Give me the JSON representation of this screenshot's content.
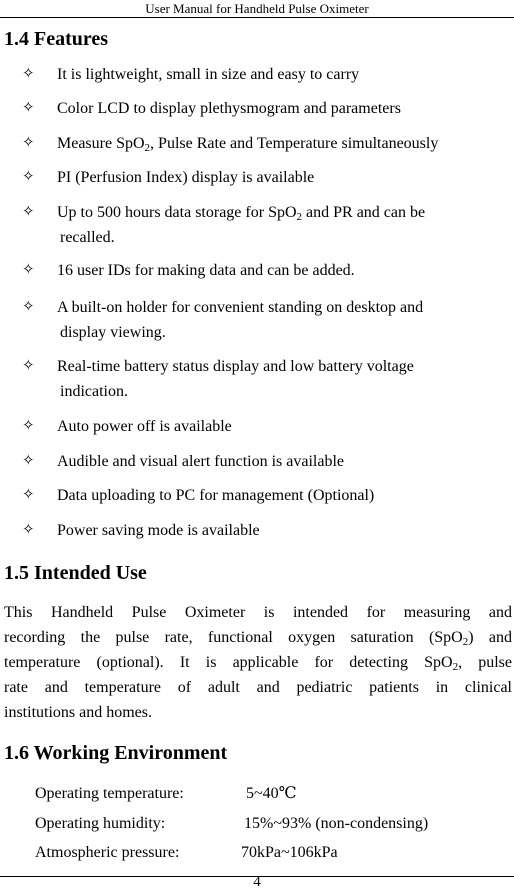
{
  "header": {
    "title": "User Manual for Handheld Pulse Oximeter"
  },
  "sections": {
    "features": {
      "heading": "1.4 Features",
      "bullet_icon": "four-pointed-star-outline-icon",
      "bullet_glyph": "✧",
      "items": [
        {
          "text": "It is lightweight, small in size and easy to carry"
        },
        {
          "text": "Color LCD to display plethysmogram and parameters"
        },
        {
          "pre": "Measure SpO",
          "sub": "2",
          "post": ", Pulse Rate and Temperature simultaneously"
        },
        {
          "text": "PI (Perfusion Index) display is available"
        },
        {
          "pre": "Up to 500 hours data storage for SpO",
          "sub": "2",
          "post": " and PR and can be",
          "cont": "recalled."
        },
        {
          "text": "16 user IDs for making data and can be added."
        },
        {
          "text": "A built-on holder for convenient standing on desktop and",
          "cont": "display viewing."
        },
        {
          "text": "Real-time battery status display and low battery voltage",
          "cont": "indication."
        },
        {
          "text": "Auto power off is available"
        },
        {
          "text": "Audible and visual alert function is available"
        },
        {
          "text": "Data uploading to PC for management (Optional)"
        },
        {
          "text": "Power saving mode is available"
        }
      ]
    },
    "intended_use": {
      "heading": "1.5 Intended Use",
      "line1": "This Handheld Pulse Oximeter is intended for measuring and",
      "line2_pre": "recording the pulse rate, functional oxygen saturation (SpO",
      "line2_sub": "2",
      "line2_post": ") and",
      "line3_pre": "temperature (optional). It is applicable for detecting SpO",
      "line3_sub": "2",
      "line3_post": ", pulse",
      "line4": "rate and temperature of adult and pediatric patients in clinical",
      "line5": "institutions and homes."
    },
    "working_environment": {
      "heading": "1.6 Working Environment",
      "rows": [
        {
          "label": "Operating temperature:",
          "value": "5~40℃"
        },
        {
          "label": "Operating humidity:",
          "value": "15%~93% (non-condensing)"
        },
        {
          "label": "Atmospheric pressure:",
          "value": "70kPa~106kPa"
        }
      ]
    }
  },
  "footer": {
    "page_number": "4"
  }
}
